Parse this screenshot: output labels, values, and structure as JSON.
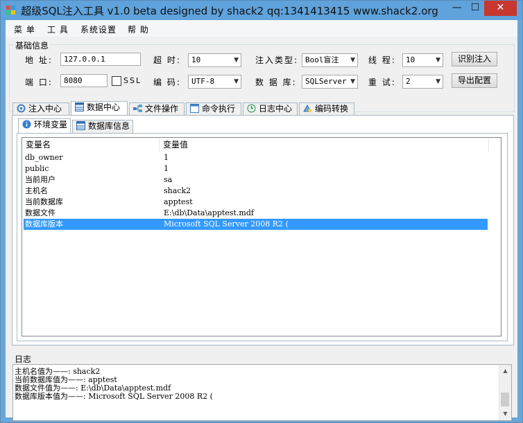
{
  "window": {
    "title": "超级SQL注入工具 v1.0 beta designed by shack2 qq:1341413415 www.shack2.org"
  },
  "menu": {
    "items": [
      "菜 单",
      "工 具",
      "系统设置",
      "帮 助"
    ]
  },
  "basic": {
    "group_title": "基础信息",
    "address_label": "地 址:",
    "address_value": "127.0.0.1",
    "timeout_label": "超 时:",
    "timeout_value": "10",
    "inject_type_label": "注入类型:",
    "inject_type_value": "Bool盲注",
    "threads_label": "线 程:",
    "threads_value": "10",
    "identify_button": "识别注入",
    "port_label": "端 口:",
    "port_value": "8080",
    "ssl_label": "SSL",
    "encoding_label": "编 码:",
    "encoding_value": "UTF-8",
    "database_label": "数 据 库:",
    "database_value": "SQLServer",
    "retry_label": "重 试:",
    "retry_value": "2",
    "export_button": "导出配置"
  },
  "tabs": [
    "注入中心",
    "数据中心",
    "文件操作",
    "命令执行",
    "日志中心",
    "编码转换"
  ],
  "subtabs": [
    "环境变量",
    "数据库信息"
  ],
  "env_table": {
    "headers": [
      "变量名",
      "变量值"
    ],
    "rows": [
      [
        "db_owner",
        "1"
      ],
      [
        "public",
        "1"
      ],
      [
        "当前用户",
        "sa"
      ],
      [
        "主机名",
        "shack2"
      ],
      [
        "当前数据库",
        "apptest"
      ],
      [
        "数据文件",
        "E:\\db\\Data\\apptest.mdf"
      ],
      [
        "数据库版本",
        "Microsoft SQL Server 2008 R2 ("
      ]
    ],
    "selected_row": 6
  },
  "log": {
    "title": "日志",
    "lines": [
      "主机名值为——: shack2",
      "当前数据库值为——: apptest",
      "数据文件值为——: E:\\db\\Data\\apptest.mdf",
      "数据库版本值为——: Microsoft SQL Server 2008 R2 ("
    ]
  },
  "colors": {
    "title_bar": "#5fa2dc",
    "close_button": "#c7372f",
    "selection": "#3399ff"
  }
}
